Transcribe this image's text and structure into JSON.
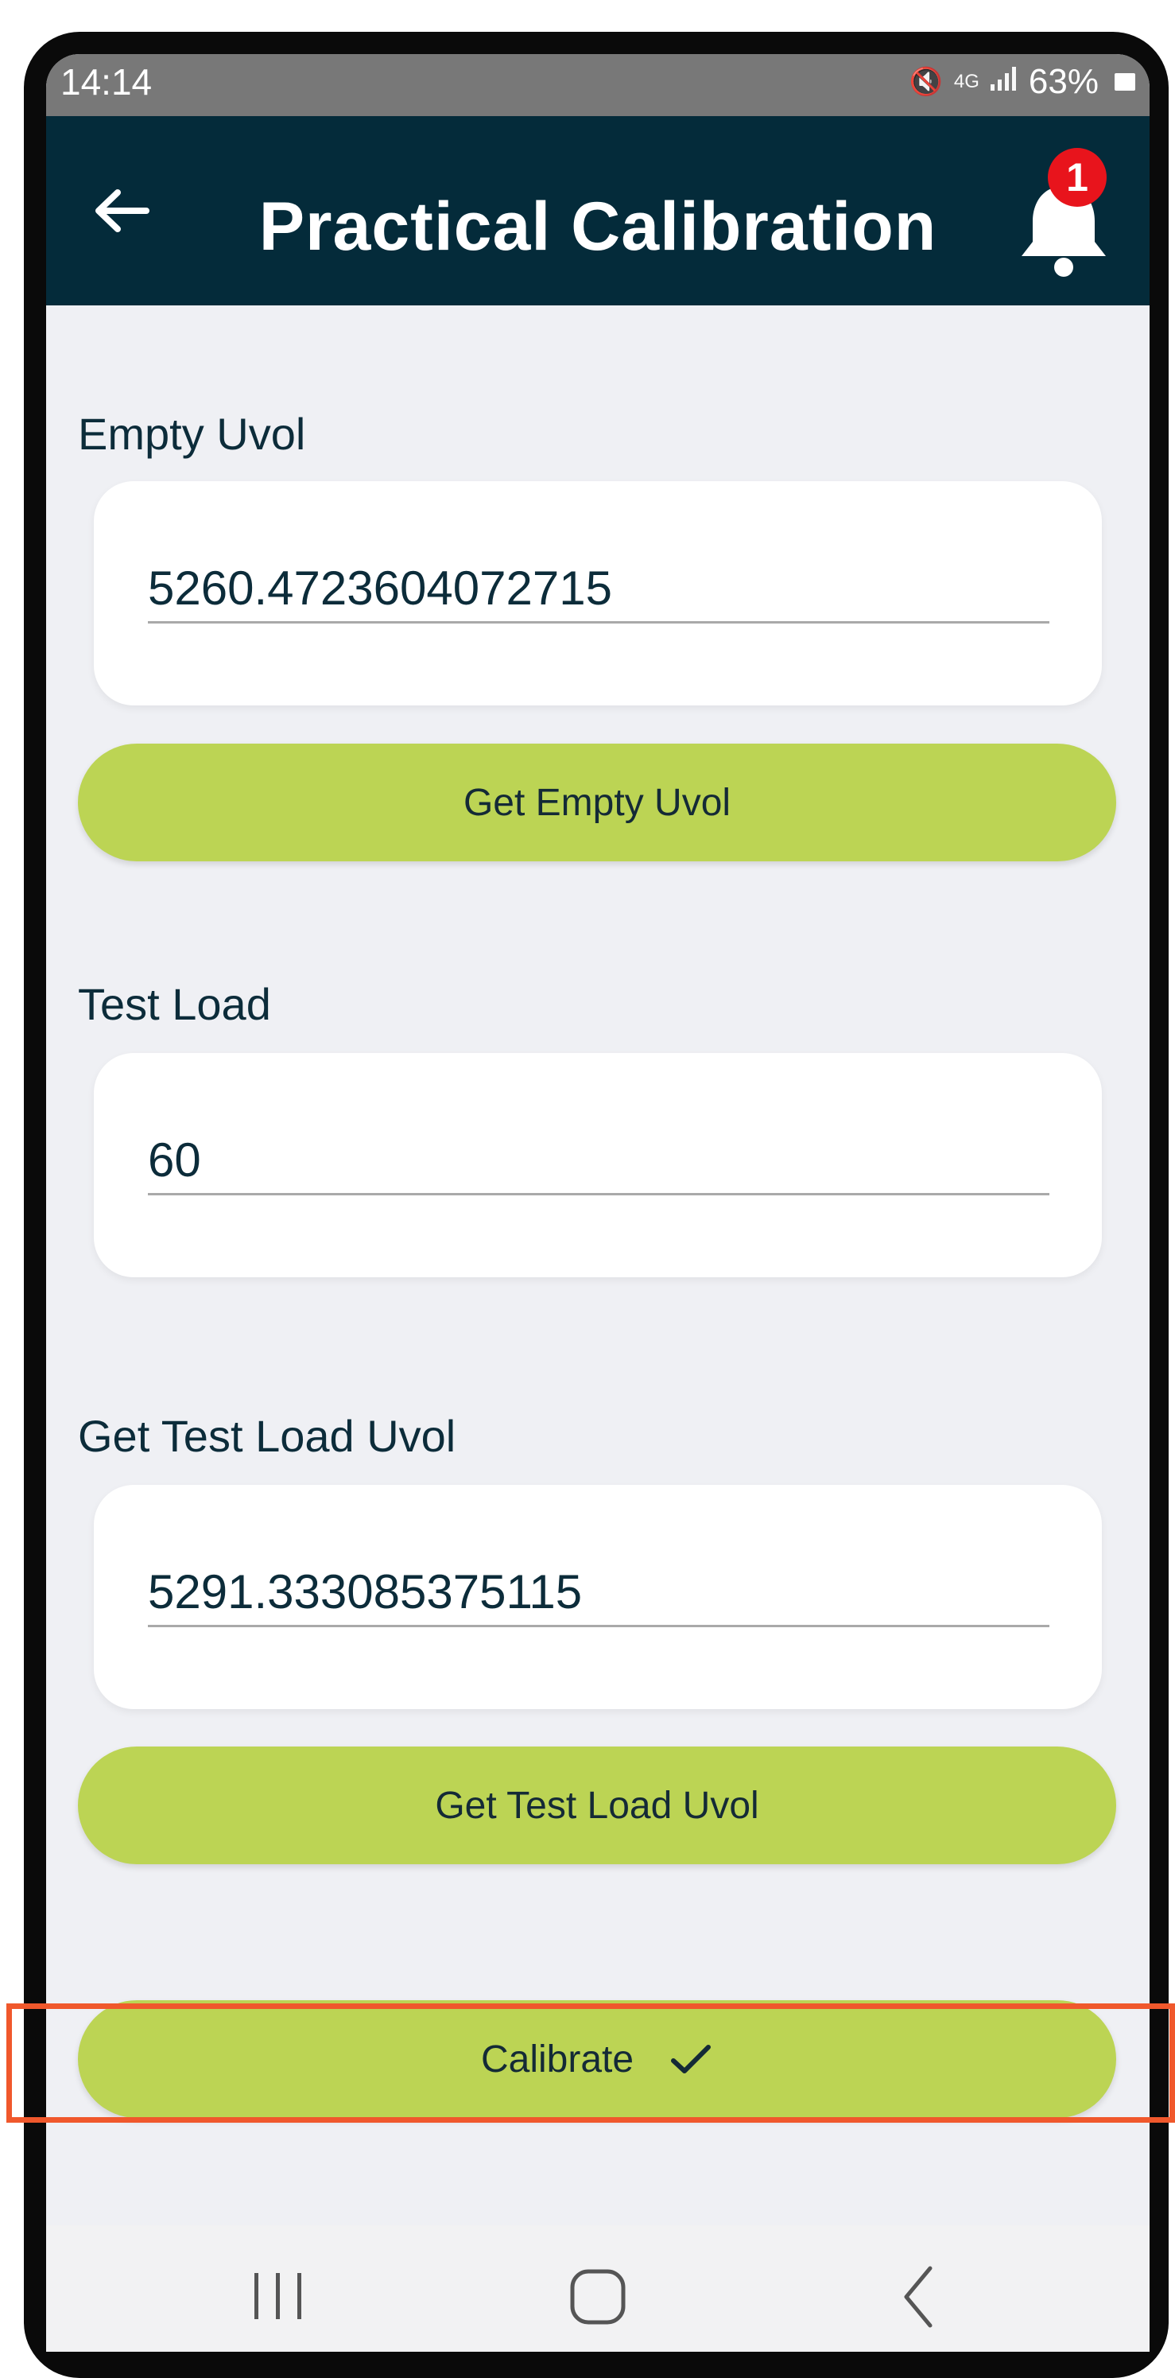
{
  "status_bar": {
    "time": "14:14",
    "network": "4G",
    "battery": "63%"
  },
  "app_bar": {
    "title": "Practical Calibration",
    "notification_count": "1"
  },
  "fields": {
    "empty_uvol": {
      "label": "Empty Uvol",
      "value": "5260.4723604072715"
    },
    "test_load": {
      "label": "Test Load",
      "value": "60"
    },
    "test_load_uvol": {
      "label": "Get Test Load Uvol",
      "value": "5291.333085375115"
    }
  },
  "buttons": {
    "get_empty_uvol": "Get Empty Uvol",
    "get_test_load_uvol": "Get Test Load Uvol",
    "calibrate": "Calibrate"
  },
  "colors": {
    "app_bar": "#042b3a",
    "accent_button": "#bcd454",
    "badge": "#e8141c",
    "highlight": "#f0582c"
  }
}
